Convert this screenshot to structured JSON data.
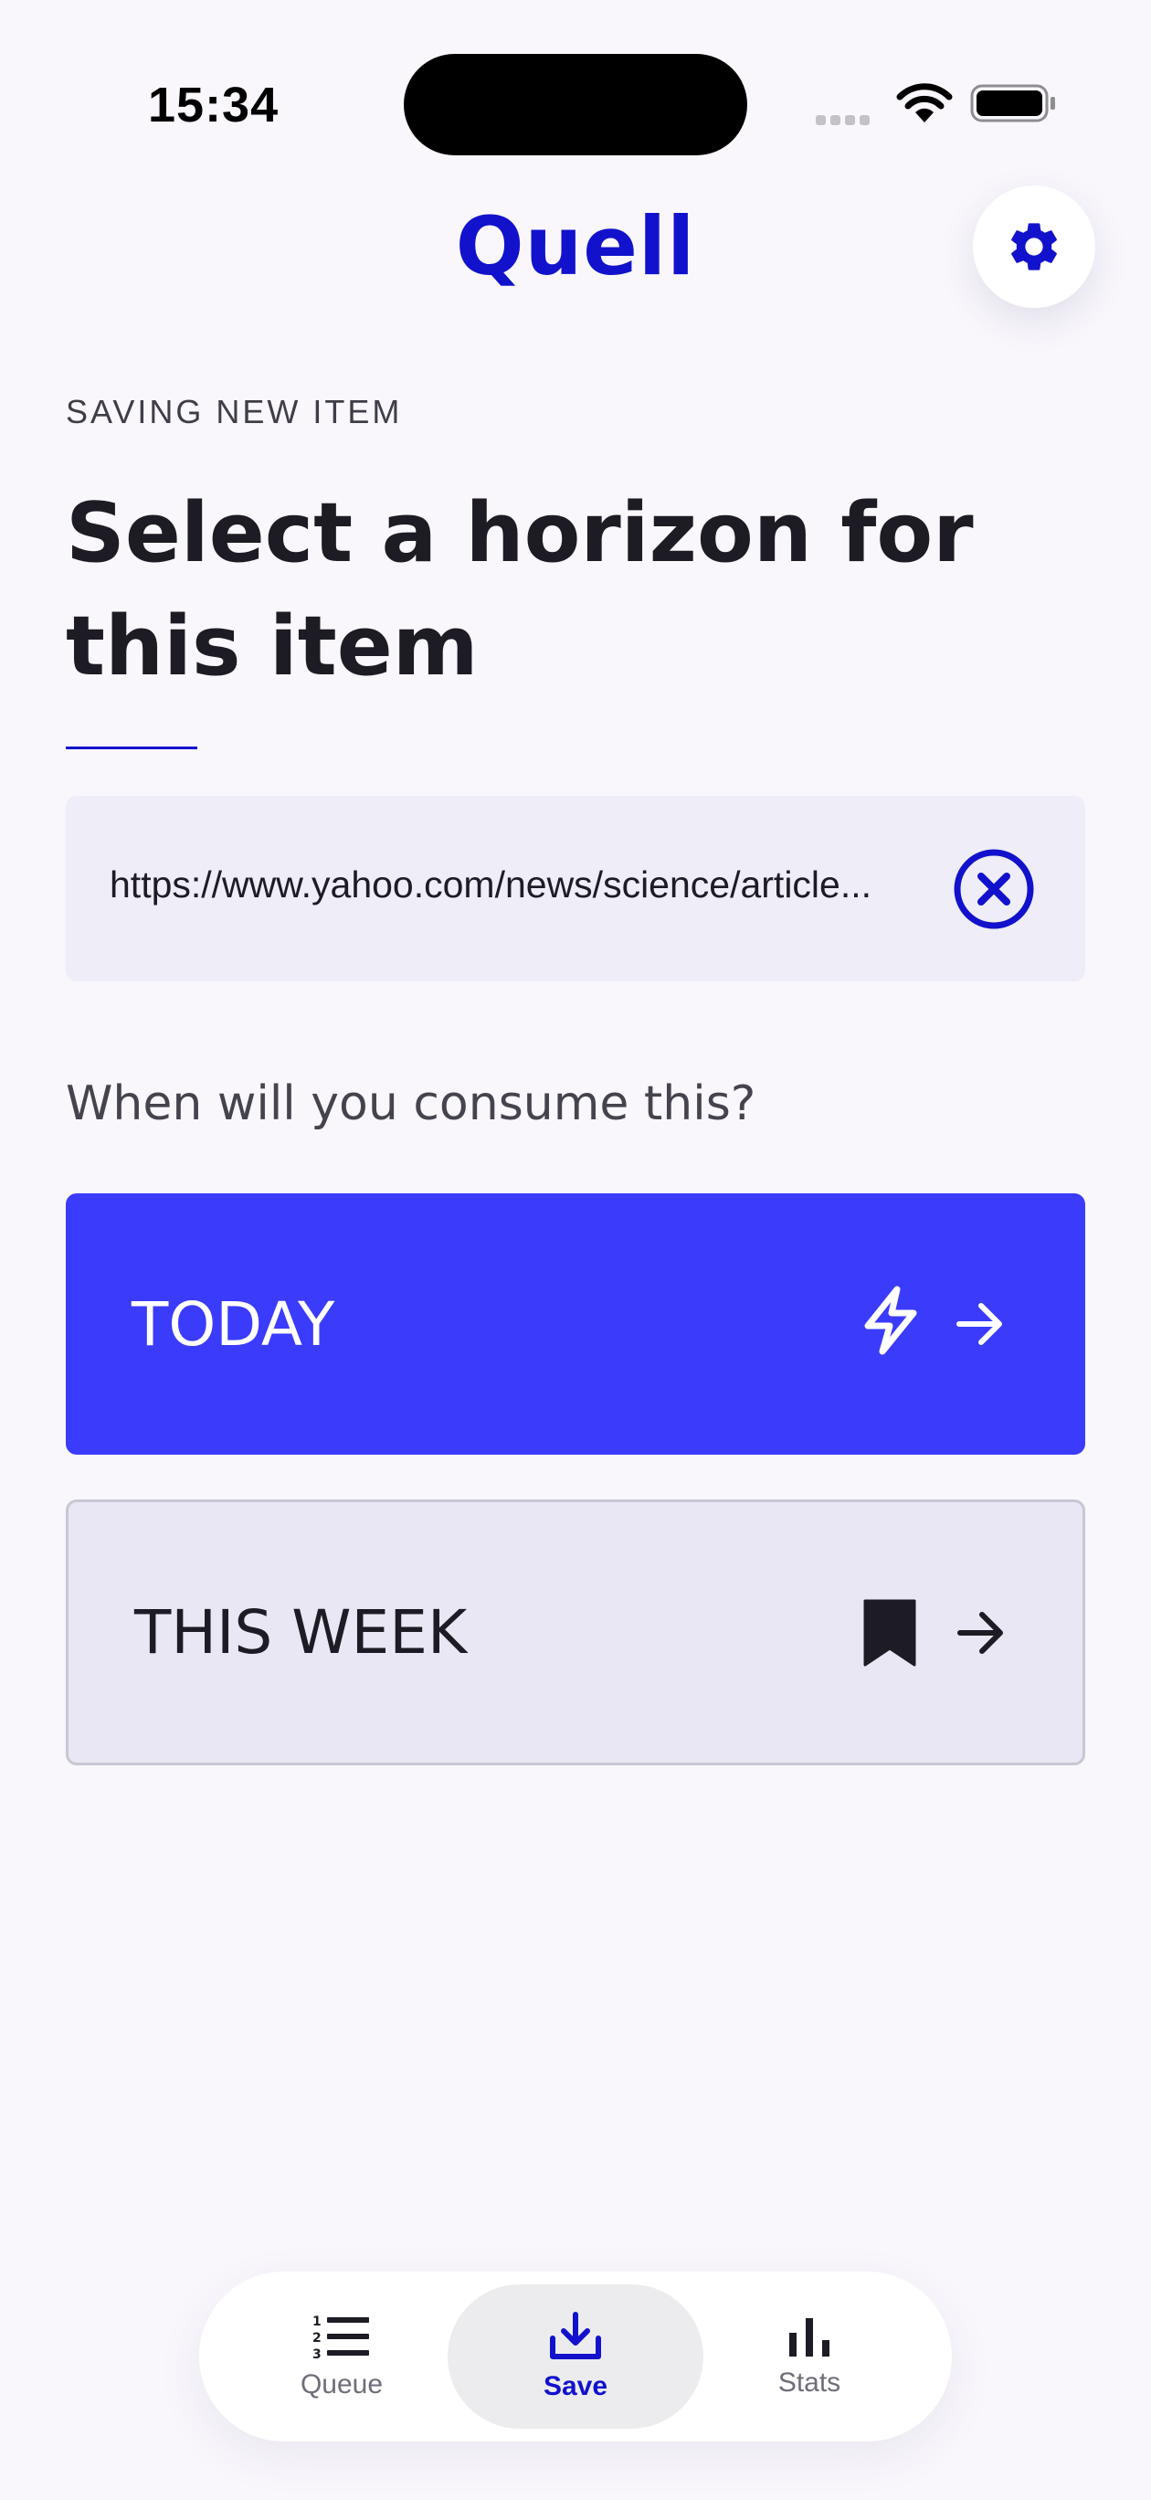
{
  "status_bar": {
    "time": "15:34"
  },
  "header": {
    "app_title": "Quell",
    "settings_icon": "gear-icon"
  },
  "page": {
    "eyebrow": "SAVING NEW ITEM",
    "headline": "Select a horizon for this item"
  },
  "url_field": {
    "value": "https://www.yahoo.com/news/science/article...",
    "clear_icon": "clear-x-circle-icon"
  },
  "question": "When will you consume this?",
  "options": [
    {
      "label": "TODAY",
      "icon": "lightning-icon",
      "arrow": "arrow-right-icon",
      "selected": true
    },
    {
      "label": "THIS WEEK",
      "icon": "bookmark-icon",
      "arrow": "arrow-right-icon",
      "selected": false
    }
  ],
  "bottom_nav": {
    "items": [
      {
        "label": "Queue",
        "icon": "ordered-list-icon",
        "active": false
      },
      {
        "label": "Save",
        "icon": "download-tray-icon",
        "active": true
      },
      {
        "label": "Stats",
        "icon": "bar-chart-icon",
        "active": false
      }
    ]
  },
  "colors": {
    "brand": "#1212cc",
    "primary_button": "#3b3bfb",
    "background": "#f9f7fc",
    "url_box": "#eeedf8",
    "secondary_button": "#e8e7f3"
  }
}
